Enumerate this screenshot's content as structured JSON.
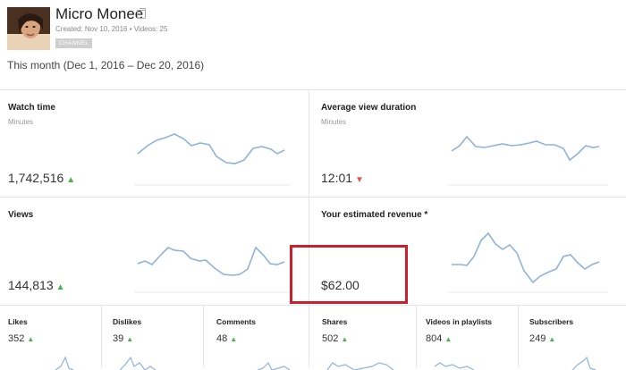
{
  "channel": {
    "name": "Micro Monee",
    "meta": "Created: Nov 10, 2016  •  Videos: 25",
    "badge": "CHANNEL"
  },
  "period": "This month (Dec 1, 2016 – Dec 20, 2016)",
  "cards": {
    "watch_time": {
      "title": "Watch time",
      "subtitle": "Minutes",
      "value": "1,742,516",
      "trend": "up"
    },
    "avg_view_duration": {
      "title": "Average view duration",
      "subtitle": "Minutes",
      "value": "12:01",
      "trend": "down"
    },
    "views": {
      "title": "Views",
      "value": "144,813",
      "trend": "up"
    },
    "revenue": {
      "title": "Your estimated revenue *",
      "value": "$62.00"
    }
  },
  "small_metrics": [
    {
      "label": "Likes",
      "value": "352"
    },
    {
      "label": "Dislikes",
      "value": "39"
    },
    {
      "label": "Comments",
      "value": "48"
    },
    {
      "label": "Shares",
      "value": "502"
    },
    {
      "label": "Videos in playlists",
      "value": "804"
    },
    {
      "label": "Subscribers",
      "value": "249"
    }
  ],
  "icons": {
    "trend_up": "▲",
    "trend_down": "▼"
  },
  "colors": {
    "sparkline": "#8fb3d9",
    "trend_up": "#4caf50",
    "trend_down": "#e05a4f",
    "highlight_box": "#c8202d"
  }
}
